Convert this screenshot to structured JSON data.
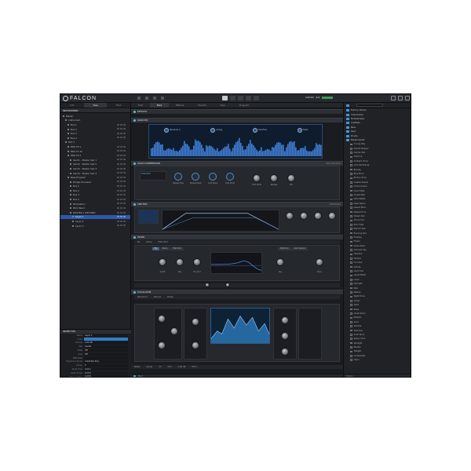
{
  "app": {
    "name": "FALCON"
  },
  "topbar": {
    "tempo": "120.00",
    "signature": "4/4"
  },
  "left": {
    "tabs": [
      "Info",
      "Tree",
      "Mod"
    ],
    "panel_title": "INSTRUMENT",
    "tree": [
      {
        "label": "Master",
        "indent": 0
      },
      {
        "label": "Instrument",
        "indent": 1
      },
      {
        "label": "Bus 1",
        "indent": 2
      },
      {
        "label": "Bus 2",
        "indent": 2
      },
      {
        "label": "Bus 3",
        "indent": 2
      },
      {
        "label": "Bus 4",
        "indent": 2
      },
      {
        "label": "Part 1",
        "indent": 1
      },
      {
        "label": "MIDI FX 1",
        "indent": 2
      },
      {
        "label": "MIDI FX 1b",
        "indent": 2
      },
      {
        "label": "MIDI FX 2",
        "indent": 2
      },
      {
        "label": "Send1 - Master Sed 1",
        "indent": 3
      },
      {
        "label": "Send2 - Master Sed 2",
        "indent": 3
      },
      {
        "label": "Send3 - Master Sed 3",
        "indent": 3
      },
      {
        "label": "Send4 - Master Sed 4",
        "indent": 3
      },
      {
        "label": "Bass Program",
        "indent": 2
      },
      {
        "label": "Bridge Processor",
        "indent": 3
      },
      {
        "label": "Bus 1",
        "indent": 3
      },
      {
        "label": "Bus 2",
        "indent": 3
      },
      {
        "label": "Bus 3",
        "indent": 3
      },
      {
        "label": "Bus 4",
        "indent": 3
      },
      {
        "label": "Modulation",
        "indent": 3
      },
      {
        "label": "Pitch Bend",
        "indent": 3
      },
      {
        "label": "MASTER 1 (KEYGEN)",
        "indent": 3
      },
      {
        "label": "Layer 1",
        "indent": 4,
        "selected": true
      },
      {
        "label": "Layer 2",
        "indent": 4
      },
      {
        "label": "Layer 3",
        "indent": 4
      }
    ],
    "inspector": {
      "title": "INSPECTOR",
      "rows": [
        {
          "key": "Name",
          "value": "Layer 1"
        },
        {
          "key": "Color",
          "value": "",
          "highlight": true
        },
        {
          "key": "Volume",
          "value": "0.00 dB"
        },
        {
          "key": "Pan",
          "value": "Center"
        },
        {
          "key": "Mute",
          "value": "Off"
        },
        {
          "key": "Solo",
          "value": "Off"
        },
        {
          "key": "MIDI Note",
          "value": ""
        },
        {
          "key": "Polyphony Mode",
          "value": "Unlimited Poly"
        },
        {
          "key": "Voices",
          "value": "0"
        },
        {
          "key": "Glide Time",
          "value": "0.00 s"
        },
        {
          "key": "Glide Time2",
          "value": "0.00%"
        },
        {
          "key": "Release Time",
          "value": "0.00%"
        }
      ]
    }
  },
  "center": {
    "tabs": [
      "Edit",
      "Mod",
      "Effects",
      "Events",
      "Tree",
      "Program"
    ],
    "sections": {
      "effects_header": "EFFECTS",
      "eq_header": "SOLID EQ",
      "eq_knobs": [
        "Bass/Low Q",
        "Analog",
        "Gain/Freq",
        "Treble"
      ],
      "comp_header": "SOLID COMPRESSOR",
      "comp_mode": "Tube Modular",
      "comp_labels": [
        "Hold Mode",
        "Tube Mod",
        "Release",
        "Mix"
      ],
      "comp_knob_labels": [
        "Release Freq",
        "Modes Depth",
        "Limit Slope",
        "Hold Mode"
      ],
      "env_header": "AMP ENV",
      "env_mode": "Amplitude",
      "filter_header": "FILTER",
      "filter_tabs": [
        "Eq",
        "Ramp",
        "Filter Mod",
        "Distortion",
        "Sub Channel"
      ],
      "filter_knobs": [
        "Cutoff",
        "Res",
        "Env Amt",
        "Key",
        "Drive"
      ],
      "osc_header": "OSCILLATOR",
      "osc_labels": [
        "Waveform",
        "Detune",
        "Shape"
      ],
      "osc_knobs": [
        "Sound",
        "Phase",
        "Level",
        "Speed"
      ]
    },
    "footer": [
      "Notes",
      "Voices",
      "C4",
      "CPU",
      "0.00 dB",
      "Pitch"
    ]
  },
  "right": {
    "folders": [
      "Factory Library",
      "Instruments",
      "Multisamples",
      "Arp/Seqs",
      "Bass",
      "Keys",
      "Drums",
      "Experimental"
    ],
    "items": [
      "A Long Way",
      "Absent Sleeper",
      "Aeolian Pad",
      "Airborne",
      "Ambient Vocal",
      "Auto Pad Rising",
      "Big Sky",
      "Blue Moon",
      "Broken Voice",
      "Celesta Dream",
      "Chime Grains",
      "Cloud Walk",
      "Crystal Bell",
      "Dark Matter",
      "Deep Space",
      "Desert Wind",
      "Distant Horn",
      "Dream Pad",
      "Drone One",
      "Echo Field",
      "Electric Rain",
      "Evolving Pad",
      "Floating",
      "Frozen",
      "Glass Wave",
      "Granular Sky",
      "Haunted",
      "Horizon",
      "Ice Cave",
      "Infinite",
      "Lava Flow",
      "Liquid Metal",
      "Lunar",
      "Midnight",
      "Mist",
      "Nebula",
      "Night Drive",
      "Ocean",
      "Orbit",
      "Pulse",
      "Quiet Storm",
      "Radiant",
      "Sand",
      "Shadow",
      "Shimmer",
      "Solar Wind",
      "Space Choir",
      "Starlight",
      "Stratos",
      "Twilight",
      "Underwater",
      "Vapor"
    ],
    "footer": "Factory"
  },
  "colors": {
    "accent": "#2f7fc4",
    "selection": "#2f58a8",
    "eq_bg": "#0f1c2e",
    "eq_line": "#4f8fd8"
  }
}
